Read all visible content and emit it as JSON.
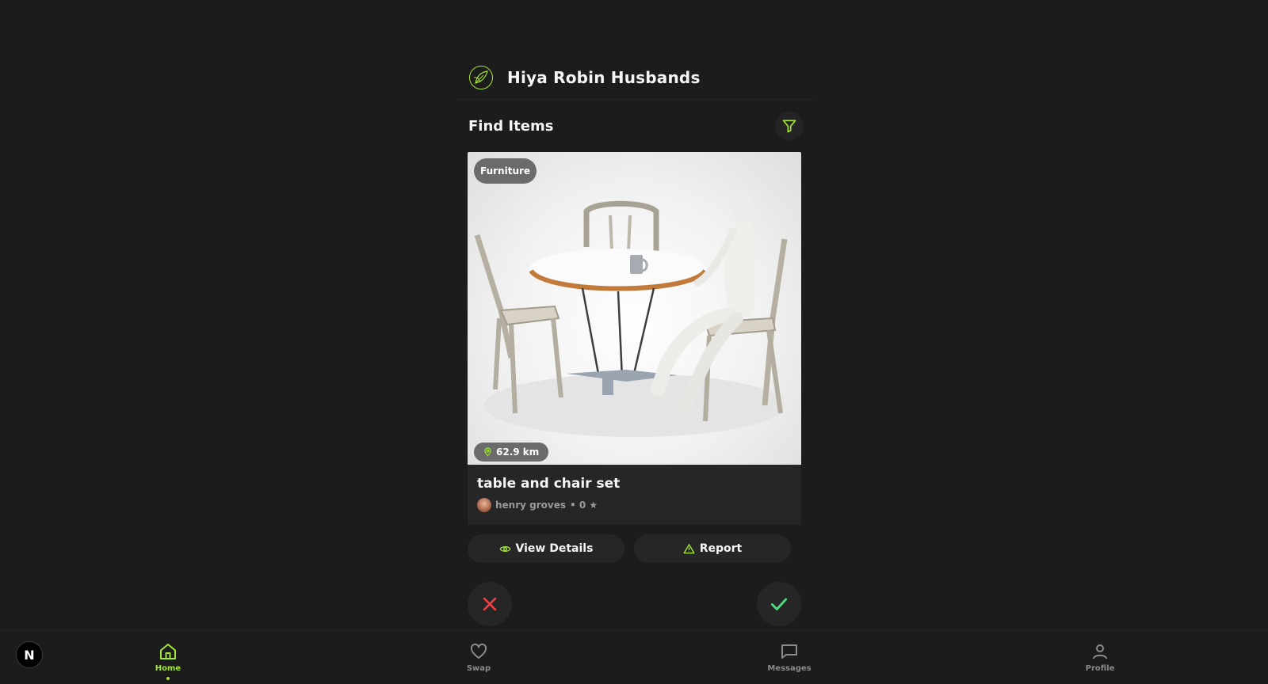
{
  "header": {
    "title": "Hiya Robin Husbands",
    "logo_icon": "leaf-logo-icon"
  },
  "section": {
    "title": "Find Items",
    "filter_icon": "filter-icon"
  },
  "item": {
    "category": "Furniture",
    "distance": "62.9 km",
    "title": "table and chair set",
    "owner": "henry groves",
    "meta": "• 0 ★"
  },
  "actions": {
    "view_details": "View Details",
    "report": "Report"
  },
  "nav": {
    "items": [
      {
        "label": "Home",
        "icon": "home-icon",
        "active": true
      },
      {
        "label": "Swap",
        "icon": "heart-icon",
        "active": false
      },
      {
        "label": "Messages",
        "icon": "message-icon",
        "active": false
      },
      {
        "label": "Profile",
        "icon": "profile-icon",
        "active": false
      }
    ]
  },
  "dev_badge": "N",
  "colors": {
    "accent": "#a3e635",
    "reject": "#ef4444",
    "accept": "#4ade80",
    "background": "#1c1c1c",
    "surface": "#262626"
  }
}
